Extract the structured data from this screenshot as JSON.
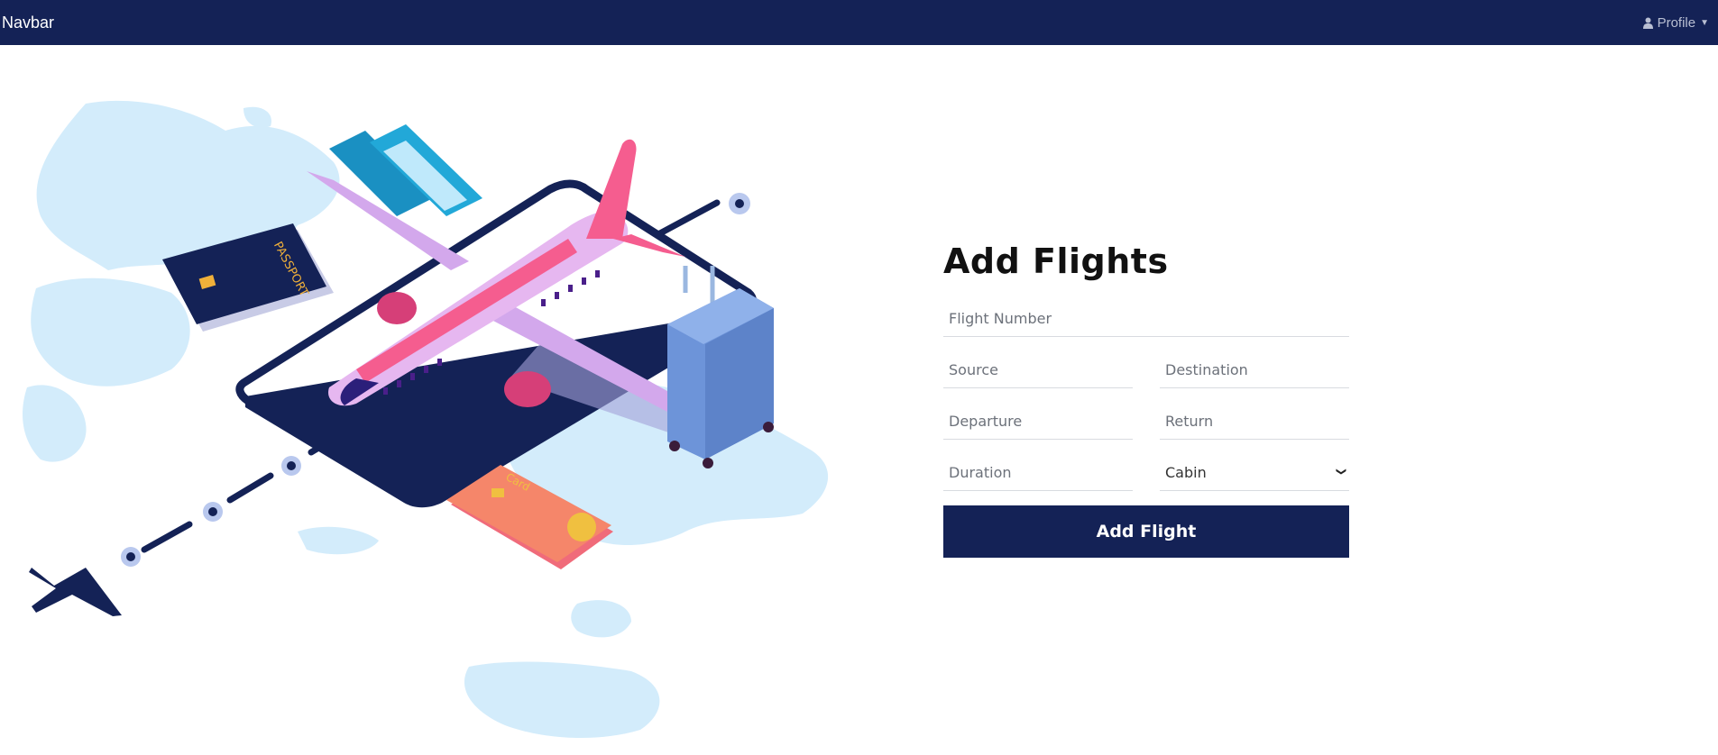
{
  "navbar": {
    "brand": "Navbar",
    "profile_label": "Profile",
    "profile_icon": "user-icon"
  },
  "illustration": {
    "passport_text": "PASSPORT",
    "card_text": "Card"
  },
  "form": {
    "title": "Add Flights",
    "flight_number_placeholder": "Flight Number",
    "source_placeholder": "Source",
    "destination_placeholder": "Destination",
    "departure_placeholder": "Departure",
    "return_placeholder": "Return",
    "duration_placeholder": "Duration",
    "cabin_selected": "Cabin",
    "submit_label": "Add Flight"
  },
  "colors": {
    "navbar_bg": "#142256",
    "button_bg": "#142256",
    "map_blue": "#d3ecfb"
  }
}
